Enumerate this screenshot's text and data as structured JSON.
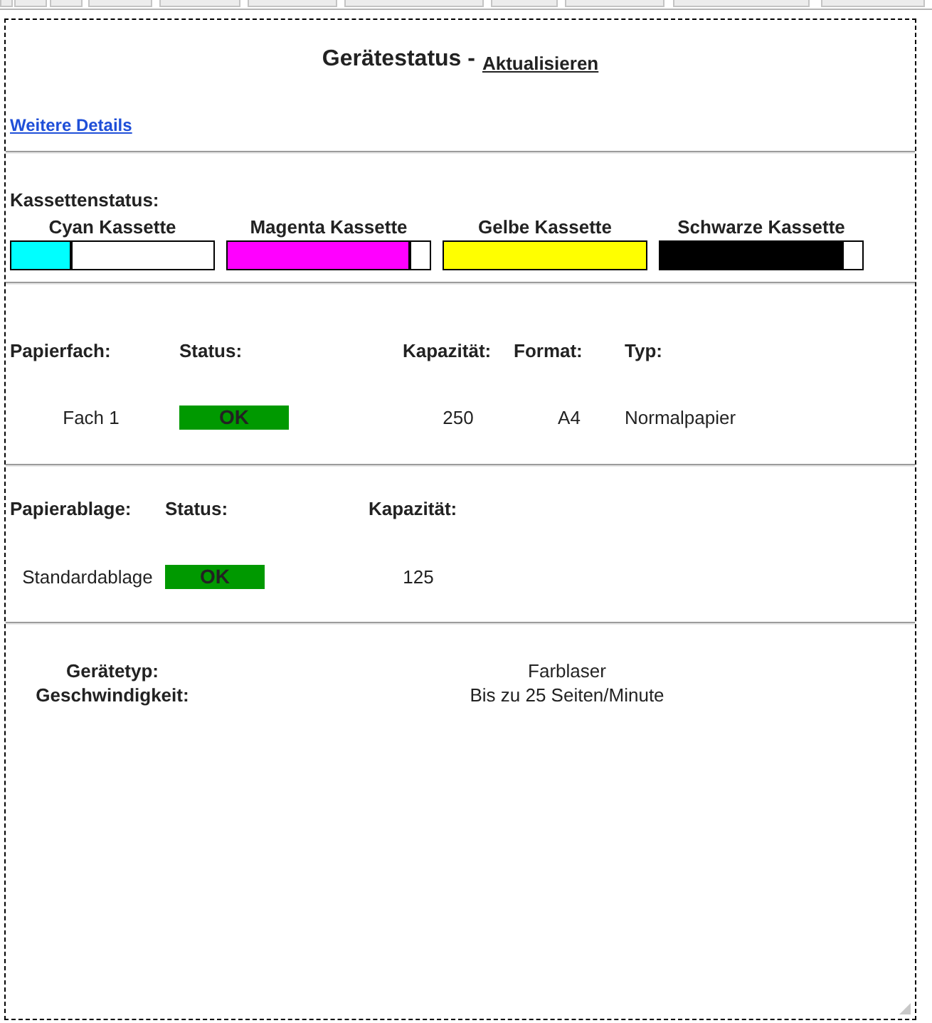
{
  "title": {
    "text": "Gerätestatus -",
    "refresh_link": "Aktualisieren"
  },
  "details_link": "Weitere Details",
  "cartridges": {
    "heading": "Kassettenstatus:",
    "items": [
      {
        "name": "Cyan Kassette",
        "color": "#00ffff",
        "level": 0.3
      },
      {
        "name": "Magenta Kassette",
        "color": "#ff00ff",
        "level": 0.91
      },
      {
        "name": "Gelbe Kassette",
        "color": "#ffff00",
        "level": 1
      },
      {
        "name": "Schwarze Kassette",
        "color": "#000000",
        "level": 0.91
      }
    ]
  },
  "paper_trays": {
    "columns": [
      "Papierfach:",
      "Status:",
      "Kapazität:",
      "Format:",
      "Typ:"
    ],
    "rows": [
      {
        "name": "Fach 1",
        "status": {
          "label": "OK",
          "kind": "ok"
        },
        "capacity": "250",
        "format": "A4",
        "type": "Normalpapier"
      }
    ]
  },
  "output_trays": {
    "columns": [
      "Papierablage:",
      "Status:",
      "Kapazität:"
    ],
    "rows": [
      {
        "name": "Standardablage",
        "status": {
          "label": "OK",
          "kind": "ok"
        },
        "capacity": "125"
      }
    ]
  },
  "device_info": [
    {
      "label": "Gerätetyp:",
      "value": "Farblaser"
    },
    {
      "label": "Geschwindigkeit:",
      "value": "Bis zu 25 Seiten/Minute"
    }
  ]
}
